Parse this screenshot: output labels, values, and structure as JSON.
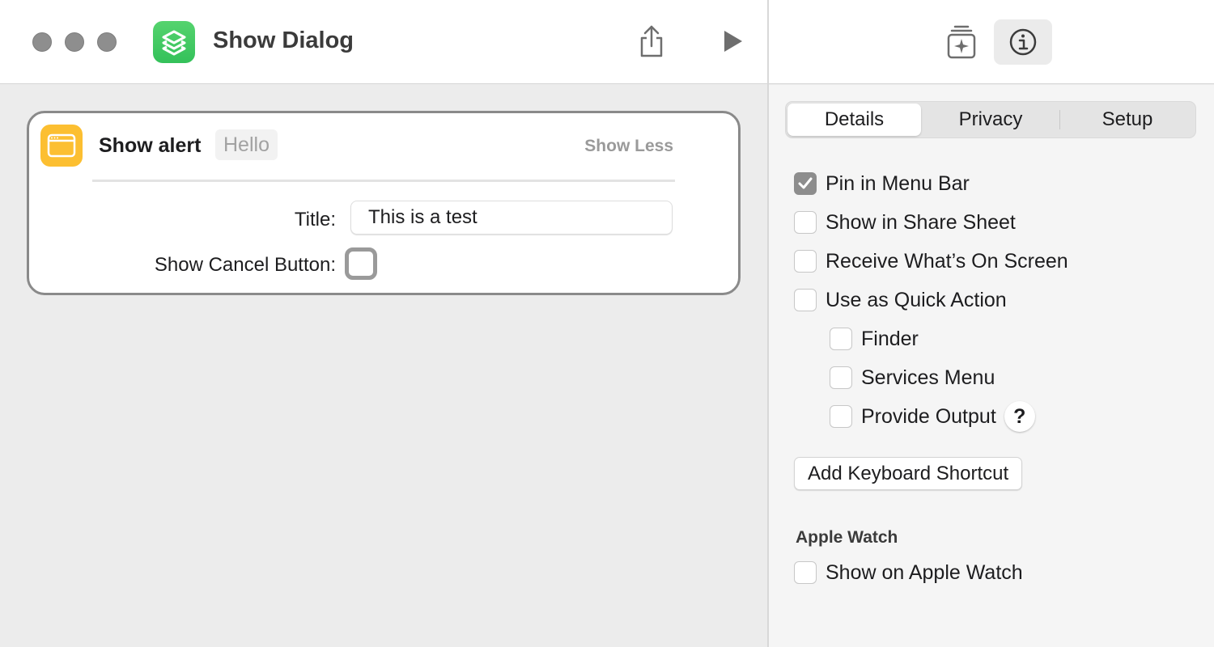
{
  "window": {
    "title": "Show Dialog",
    "app_icon": "shortcuts-icon",
    "toolbar": {
      "share_icon": "share-icon",
      "run_icon": "play-icon",
      "library_icon": "action-library-icon",
      "info_icon": "info-icon"
    }
  },
  "action": {
    "icon": "alert-window-icon",
    "name": "Show alert",
    "token": "Hello",
    "show_less": "Show Less",
    "title_label": "Title:",
    "title_value": "This is a test",
    "cancel_label": "Show Cancel Button:",
    "cancel_checked": false
  },
  "inspector": {
    "tabs": [
      {
        "label": "Details",
        "selected": true
      },
      {
        "label": "Privacy",
        "selected": false
      },
      {
        "label": "Setup",
        "selected": false
      }
    ],
    "options": [
      {
        "label": "Pin in Menu Bar",
        "checked": true
      },
      {
        "label": "Show in Share Sheet",
        "checked": false
      },
      {
        "label": "Receive What’s On Screen",
        "checked": false
      },
      {
        "label": "Use as Quick Action",
        "checked": false
      }
    ],
    "quick_action_options": [
      {
        "label": "Finder",
        "checked": false
      },
      {
        "label": "Services Menu",
        "checked": false
      },
      {
        "label": "Provide Output",
        "checked": false
      }
    ],
    "help_label": "?",
    "keyboard_shortcut_button": "Add Keyboard Shortcut",
    "apple_watch_heading": "Apple Watch",
    "apple_watch_option": {
      "label": "Show on Apple Watch",
      "checked": false
    }
  },
  "colors": {
    "app_icon_green": "#34c15a",
    "action_icon_yellow": "#fcbf31",
    "checked_gray": "#8d8d8d"
  }
}
